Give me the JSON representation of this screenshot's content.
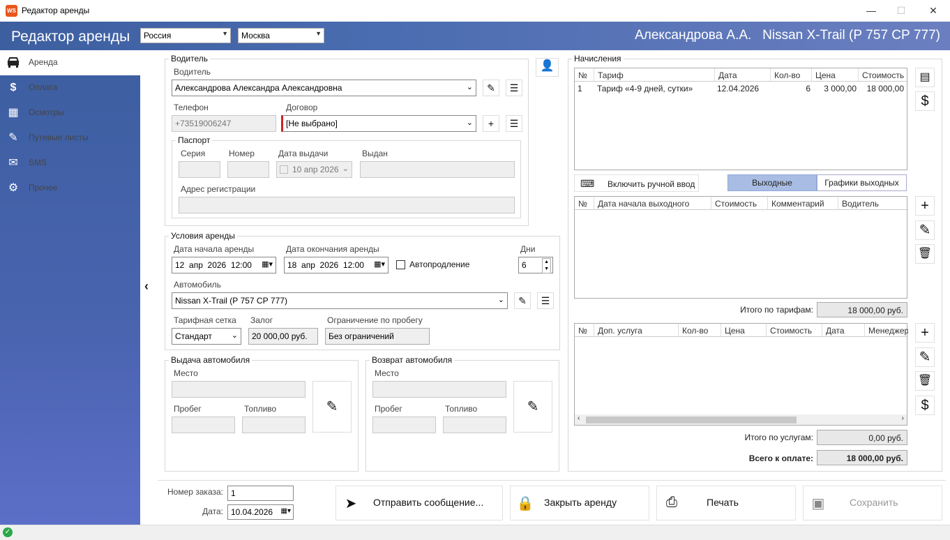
{
  "window": {
    "title": "Редактор аренды",
    "icon_text": "WS",
    "min": "—",
    "max": "☐",
    "close": "✕"
  },
  "header": {
    "title": "Редактор аренды",
    "country": "Россия",
    "city": "Москва",
    "right_text": "Александрова А.А.   Nissan X-Trail (Р 757 СР 777)"
  },
  "sidebar": {
    "items": [
      {
        "label": "Аренда",
        "icon": "car-icon"
      },
      {
        "label": "Оплата",
        "icon": "dollar-icon"
      },
      {
        "label": "Осмотры",
        "icon": "inspection-icon"
      },
      {
        "label": "Путевые листы",
        "icon": "waybill-icon"
      },
      {
        "label": "SMS",
        "icon": "mail-icon"
      },
      {
        "label": "Прочее",
        "icon": "gear-icon"
      }
    ]
  },
  "driver": {
    "group_title": "Водитель",
    "driver_label": "Водитель",
    "driver_value": "Александрова Александра Александровна",
    "phone_label": "Телефон",
    "phone_value": "+73519006247",
    "contract_label": "Договор",
    "contract_value": "[Не выбрано]",
    "passport_title": "Паспорт",
    "series_label": "Серия",
    "number_label": "Номер",
    "issue_date_label": "Дата выдачи",
    "issue_date_value": "10  апр  2026",
    "issued_by_label": "Выдан",
    "address_label": "Адрес регистрации"
  },
  "terms": {
    "group_title": "Условия аренды",
    "start_label": "Дата начала аренды",
    "start_value": "12  апр  2026  12:00",
    "end_label": "Дата окончания аренды",
    "end_value": "18  апр  2026  12:00",
    "autoextend_label": "Автопродление",
    "days_label": "Дни",
    "days_value": "6",
    "car_label": "Автомобиль",
    "car_value": "Nissan X-Trail (Р 757 СР 777)",
    "tariff_grid_label": "Тарифная сетка",
    "tariff_grid_value": "Стандарт",
    "deposit_label": "Залог",
    "deposit_value": "20 000,00 руб.",
    "mileage_label": "Ограничение по пробегу",
    "mileage_value": "Без ограничений"
  },
  "issue": {
    "title": "Выдача автомобиля",
    "place_label": "Место",
    "mileage_label": "Пробег",
    "fuel_label": "Топливо"
  },
  "return": {
    "title": "Возврат автомобиля",
    "place_label": "Место",
    "mileage_label": "Пробег",
    "fuel_label": "Топливо"
  },
  "footer": {
    "order_label": "Номер заказа:",
    "order_value": "1",
    "date_label": "Дата:",
    "date_value": "10.04.2026",
    "send_label": "Отправить сообщение...",
    "close_label": "Закрыть аренду",
    "print_label": "Печать",
    "save_label": "Сохранить"
  },
  "charges": {
    "title": "Начисления",
    "columns": [
      "№",
      "Тариф",
      "Дата",
      "Кол-во",
      "Цена",
      "Стоимость"
    ],
    "rows": [
      [
        "1",
        "Тариф «4-9 дней, сутки»",
        "12.04.2026",
        "6",
        "3 000,00",
        "18 000,00"
      ]
    ],
    "manual_label": "Включить ручной ввод",
    "tab_weekends": "Выходные",
    "tab_schedules": "Графики выходных",
    "weekend_columns": [
      "№",
      "Дата начала выходного",
      "Стоимость",
      "Комментарий",
      "Водитель"
    ],
    "tariff_total_label": "Итого по тарифам:",
    "tariff_total_value": "18 000,00 руб.",
    "service_columns": [
      "№",
      "Доп. услуга",
      "Кол-во",
      "Цена",
      "Стоимость",
      "Дата",
      "Менеджер"
    ],
    "services_total_label": "Итого по услугам:",
    "services_total_value": "0,00 руб.",
    "grand_total_label": "Всего к оплате:",
    "grand_total_value": "18 000,00 руб."
  }
}
